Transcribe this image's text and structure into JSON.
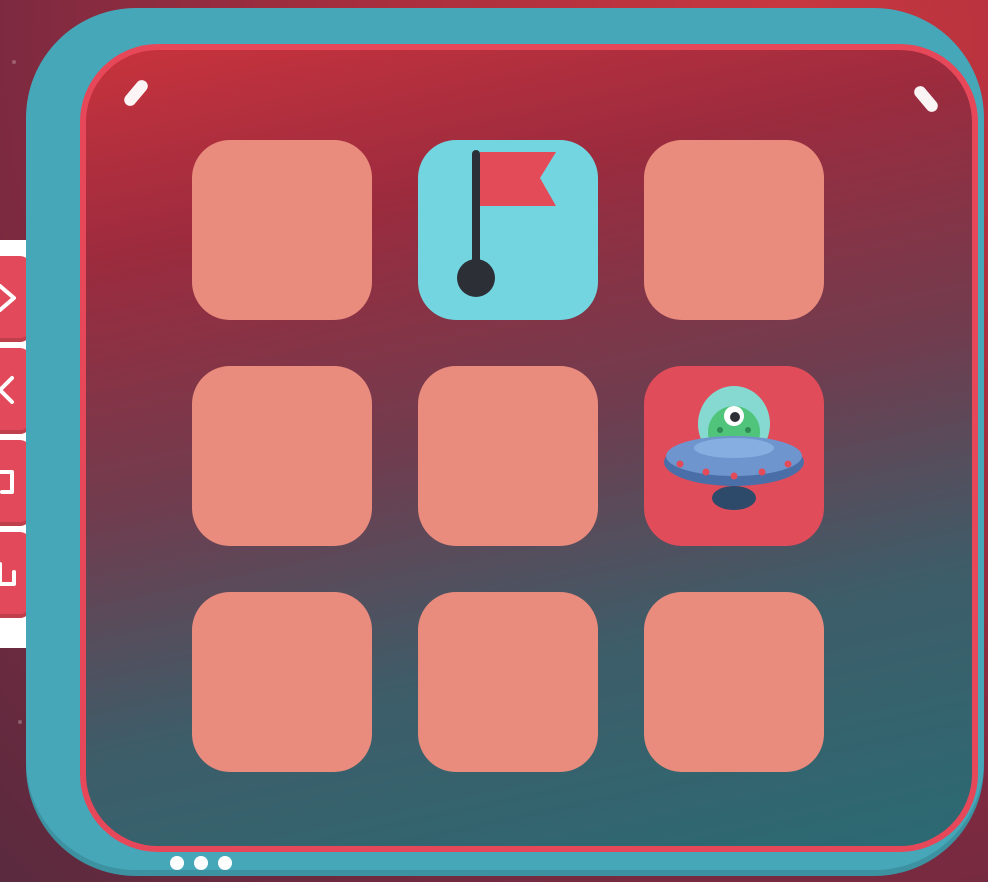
{
  "board": {
    "rows": 3,
    "cols": 3,
    "tiles": [
      {
        "row": 1,
        "col": 1,
        "state": "empty"
      },
      {
        "row": 1,
        "col": 2,
        "state": "flag"
      },
      {
        "row": 1,
        "col": 3,
        "state": "empty"
      },
      {
        "row": 2,
        "col": 1,
        "state": "empty"
      },
      {
        "row": 2,
        "col": 2,
        "state": "empty"
      },
      {
        "row": 2,
        "col": 3,
        "state": "ufo"
      },
      {
        "row": 3,
        "col": 1,
        "state": "empty"
      },
      {
        "row": 3,
        "col": 2,
        "state": "empty"
      },
      {
        "row": 3,
        "col": 3,
        "state": "empty"
      }
    ]
  },
  "side_toolbar": {
    "buttons": [
      "move-forward-icon",
      "turn-left-icon",
      "turn-right-icon",
      "loop-icon"
    ]
  },
  "pagination": {
    "dots": 3
  },
  "colors": {
    "background": "#a92e3e",
    "panel_frame": "#46a7b8",
    "panel_border": "#e6485a",
    "tile_empty": "#e98b7d",
    "tile_flag": "#73d5e0",
    "tile_ufo": "#e04c5a",
    "flag": "#e34b59"
  }
}
